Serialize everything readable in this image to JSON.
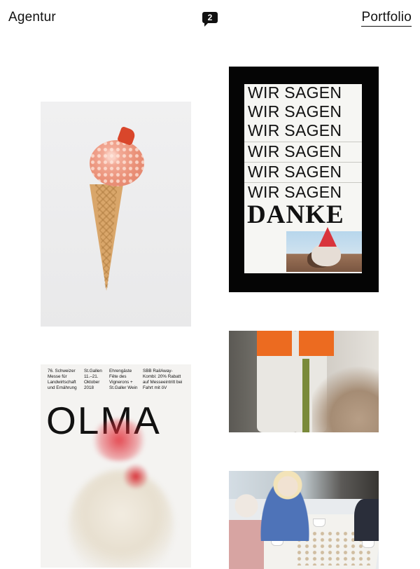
{
  "header": {
    "left_link": "Agentur",
    "badge_count": "2",
    "right_link": "Portfolio"
  },
  "tiles": {
    "icecream": {
      "subject": "ice cream cone"
    },
    "wirsagen": {
      "lines": [
        "WIR SAGEN",
        "WIR SAGEN",
        "WIR SAGEN",
        "WIR SAGEN",
        "WIR SAGEN",
        "WIR SAGEN"
      ],
      "title": "DANKE"
    },
    "worker": {
      "subject": "worker with tool"
    },
    "olma": {
      "col1": "76. Schweizer Messe für Landwirtschaft und Ernährung",
      "col2": "St.Gallen 11.–21. Oktober 2018",
      "col3": "Ehrengäste Fête des Vignerons + St.Galler Wein",
      "col4": "SBB RailAway-Kombi: 20% Rabatt auf Messeeintritt bei Fahrt mit öV",
      "title": "OLMA"
    },
    "game": {
      "subject": "seniors playing a board game"
    }
  }
}
